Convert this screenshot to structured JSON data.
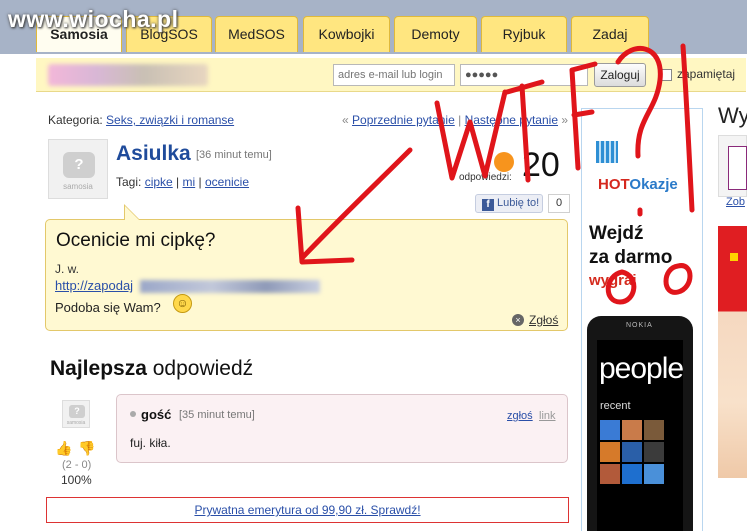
{
  "watermark": "www.wiocha.pl",
  "tabs": [
    {
      "label": "Samosia",
      "active": true
    },
    {
      "label": "BlogSOS",
      "active": false
    },
    {
      "label": "MedSOS",
      "active": false
    },
    {
      "label": "Kowbojki",
      "active": false
    },
    {
      "label": "Demoty",
      "active": false
    },
    {
      "label": "Ryjbuk",
      "active": false
    },
    {
      "label": "Zadaj",
      "active": false
    }
  ],
  "login": {
    "email_placeholder": "adres e-mail lub login",
    "password_value": "●●●●●",
    "submit_label": "Zaloguj",
    "remember_label": "zapamiętaj"
  },
  "breadcrumb": {
    "prefix": "Kategoria:",
    "category": "Seks, związki i romanse"
  },
  "pager": {
    "left_arrow": "«",
    "prev": "Poprzednie pytanie",
    "separator": "|",
    "next": "Następne pytanie",
    "right_arrow": "»"
  },
  "question": {
    "author": "Asiulka",
    "time": "[36 minut temu]",
    "tags_label": "Tagi:",
    "tags": [
      "cipke",
      "mi",
      "ocenicie"
    ],
    "answers_count": "20",
    "answers_label": "odpowiedzi:",
    "like_label": "Lubię to!",
    "like_count": "0",
    "title": "Ocenicie mi cipkę?",
    "author_line": "J. w.",
    "link_text": "http://zapodaj",
    "body": "Podoba się Wam?",
    "report_label": "Zgłoś"
  },
  "avatar_label": "samosia",
  "best_answer": {
    "title_bold": "Najlepsza",
    "title_rest": "odpowiedź",
    "user": "gość",
    "time": "[35 minut temu]",
    "report_label": "zgłoś",
    "link_label": "link",
    "text": "fuj. kiła.",
    "votes": "(2 - 0)",
    "percent": "100%"
  },
  "ad_banner": "Prywatna emerytura od 99,90 zł. Sprawdź!",
  "right_ad": {
    "brand_a": "HOT",
    "brand_b": "Okazje",
    "headline_1": "Wejdź",
    "headline_2": "za darmo",
    "cta": "wygraj",
    "phone_brand": "NOKIA",
    "phone_title": "people",
    "phone_sub": "recent"
  },
  "far_right": {
    "heading": "Wy",
    "link": "Zob"
  },
  "scribble_color": "#e0151b"
}
